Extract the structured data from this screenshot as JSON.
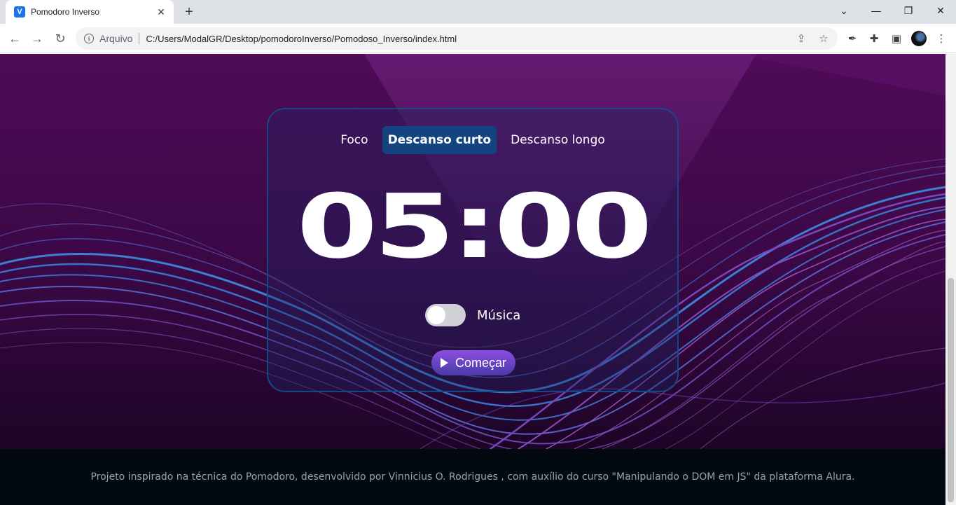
{
  "browser": {
    "tab_title": "Pomodoro Inverso",
    "favicon_letter": "V",
    "omnibox_origin": "Arquivo",
    "url": "C:/Users/ModalGR/Desktop/pomodoroInverso/Pomodoso_Inverso/index.html"
  },
  "app": {
    "modes": [
      {
        "label": "Foco",
        "active": false
      },
      {
        "label": "Descanso curto",
        "active": true
      },
      {
        "label": "Descanso longo",
        "active": false
      }
    ],
    "timer": "05:00",
    "music_label": "Música",
    "music_on": false,
    "start_label": "Começar"
  },
  "footer": {
    "text": "Projeto inspirado na técnica do Pomodoro, desenvolvido por Vinnicius O. Rodrigues , com auxílio do curso \"Manipulando o DOM em JS\" da plataforma Alura."
  },
  "colors": {
    "active_mode": "#144480",
    "card_border": "#144e8c",
    "footer_bg": "#020a10"
  }
}
